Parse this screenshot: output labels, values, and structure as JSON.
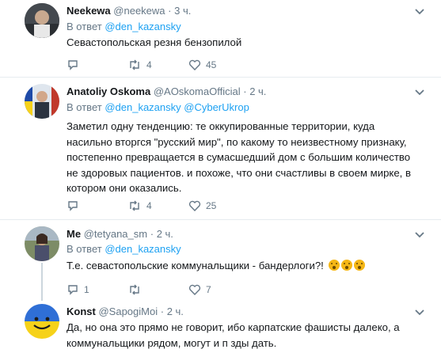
{
  "tweets": [
    {
      "name": "Neekewa",
      "handle": "@neekewa",
      "time": "3 ч.",
      "reply_prefix": "В ответ",
      "reply_to": [
        "@den_kazansky"
      ],
      "text": "Севастопольская резня бензопилой",
      "replies": "",
      "retweets": "4",
      "likes": "45"
    },
    {
      "name": "Anatoliy Oskoma",
      "handle": "@AOskomaOfficial",
      "time": "2 ч.",
      "reply_prefix": "В ответ",
      "reply_to": [
        "@den_kazansky",
        "@CyberUkrop"
      ],
      "text": "Заметил одну тенденцию: те оккупированные территории, куда насильно вторгся \"русский мир\", по какому то неизвестному признаку, постепенно превращается в сумасшедший дом с большим количество не здоровых пациентов. и похоже, что они счастливы в своем мирке, в котором они оказались.",
      "replies": "",
      "retweets": "4",
      "likes": "25"
    },
    {
      "name": "Me",
      "handle": "@tetyana_sm",
      "time": "2 ч.",
      "reply_prefix": "В ответ",
      "reply_to": [
        "@den_kazansky"
      ],
      "text": "Т.е. севастопольские коммунальщики - бандерлоги?!",
      "replies": "1",
      "retweets": "",
      "likes": "7"
    },
    {
      "name": "Konst",
      "handle": "@SapogiMoi",
      "time": "2 ч.",
      "reply_prefix": "",
      "reply_to": [],
      "text": "Да, но она это прямо не говорит, ибо карпатские фашисты далеко, а коммунальщики рядом, могут и п  зды дать.",
      "replies": "",
      "retweets": "",
      "likes": ""
    }
  ],
  "icons": {
    "reply": "reply-icon",
    "retweet": "retweet-icon",
    "like": "heart-icon",
    "caret": "chevron-down-icon"
  },
  "colors": {
    "link": "#1da1f2",
    "muted": "#657786",
    "divider": "#e6ecf0"
  }
}
